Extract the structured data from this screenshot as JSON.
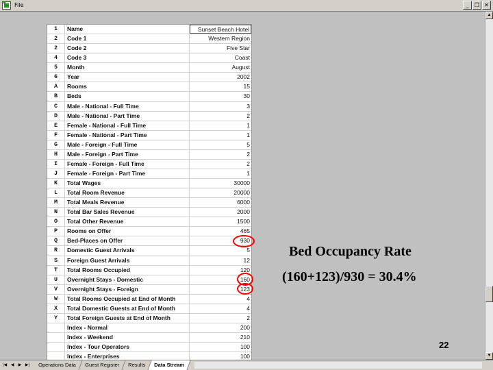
{
  "window": {
    "menu_label": "File",
    "buttons": [
      "_",
      "❐",
      "✕"
    ]
  },
  "sheet": {
    "rows": [
      {
        "code": "1",
        "label": "Name",
        "value": "Sunset Beach Hotel"
      },
      {
        "code": "2",
        "label": "Code 1",
        "value": "Western Region"
      },
      {
        "code": "2",
        "label": "Code 2",
        "value": "Five Star"
      },
      {
        "code": "4",
        "label": "Code 3",
        "value": "Coast"
      },
      {
        "code": "5",
        "label": "Month",
        "value": "August"
      },
      {
        "code": "6",
        "label": "Year",
        "value": "2002"
      },
      {
        "code": "A",
        "label": "Rooms",
        "value": "15"
      },
      {
        "code": "B",
        "label": "Beds",
        "value": "30"
      },
      {
        "code": "C",
        "label": "Male - National - Full Time",
        "value": "3"
      },
      {
        "code": "D",
        "label": "Male - National - Part Time",
        "value": "2"
      },
      {
        "code": "E",
        "label": "Female - National - Full Time",
        "value": "1"
      },
      {
        "code": "F",
        "label": "Female - National - Part Time",
        "value": "1"
      },
      {
        "code": "G",
        "label": "Male - Foreign - Full Time",
        "value": "5"
      },
      {
        "code": "H",
        "label": "Male - Foreign - Part Time",
        "value": "2"
      },
      {
        "code": "I",
        "label": "Female - Foreign - Full Time",
        "value": "2"
      },
      {
        "code": "J",
        "label": "Female - Foreign - Part Time",
        "value": "1"
      },
      {
        "code": "K",
        "label": "Total Wages",
        "value": "30000"
      },
      {
        "code": "L",
        "label": "Total Room Revenue",
        "value": "20000"
      },
      {
        "code": "M",
        "label": "Total Meals Revenue",
        "value": "6000"
      },
      {
        "code": "N",
        "label": "Total Bar Sales Revenue",
        "value": "2000"
      },
      {
        "code": "O",
        "label": "Total Other Revenue",
        "value": "1500"
      },
      {
        "code": "P",
        "label": "Rooms on Offer",
        "value": "465"
      },
      {
        "code": "Q",
        "label": "Bed-Places on Offer",
        "value": "930"
      },
      {
        "code": "R",
        "label": "Domestic Guest Arrivals",
        "value": "5"
      },
      {
        "code": "S",
        "label": "Foreign Guest Arrivals",
        "value": "12"
      },
      {
        "code": "T",
        "label": "Total Rooms Occupied",
        "value": "120"
      },
      {
        "code": "U",
        "label": "Overnight Stays - Domestic",
        "value": "160"
      },
      {
        "code": "V",
        "label": "Overnight Stays - Foreign",
        "value": "123"
      },
      {
        "code": "W",
        "label": "Total Rooms Occupied at End of Month",
        "value": "4"
      },
      {
        "code": "X",
        "label": "Total Domestic Guests at End of Month",
        "value": "4"
      },
      {
        "code": "Y",
        "label": "Total Foreign Guests at End of Month",
        "value": "2"
      },
      {
        "code": "",
        "label": "Index - Normal",
        "value": "200"
      },
      {
        "code": "",
        "label": "Index - Weekend",
        "value": "210"
      },
      {
        "code": "",
        "label": "Index - Tour Operators",
        "value": "100"
      },
      {
        "code": "",
        "label": "Index - Enterprises",
        "value": "100"
      }
    ]
  },
  "annotation": {
    "title": "Bed Occupancy Rate",
    "formula": "(160+123)/930 = 30.4%"
  },
  "slide": {
    "page_number": "22"
  },
  "tabs": {
    "nav": [
      "|◀",
      "◀",
      "▶",
      "▶|"
    ],
    "items": [
      {
        "label": "Operations Data",
        "active": false
      },
      {
        "label": "Guest Register",
        "active": false
      },
      {
        "label": "Results",
        "active": false
      },
      {
        "label": "Data Stream",
        "active": true
      }
    ]
  },
  "colors": {
    "highlight_circle": "#ff0000",
    "workspace": "#c0c0c0"
  }
}
